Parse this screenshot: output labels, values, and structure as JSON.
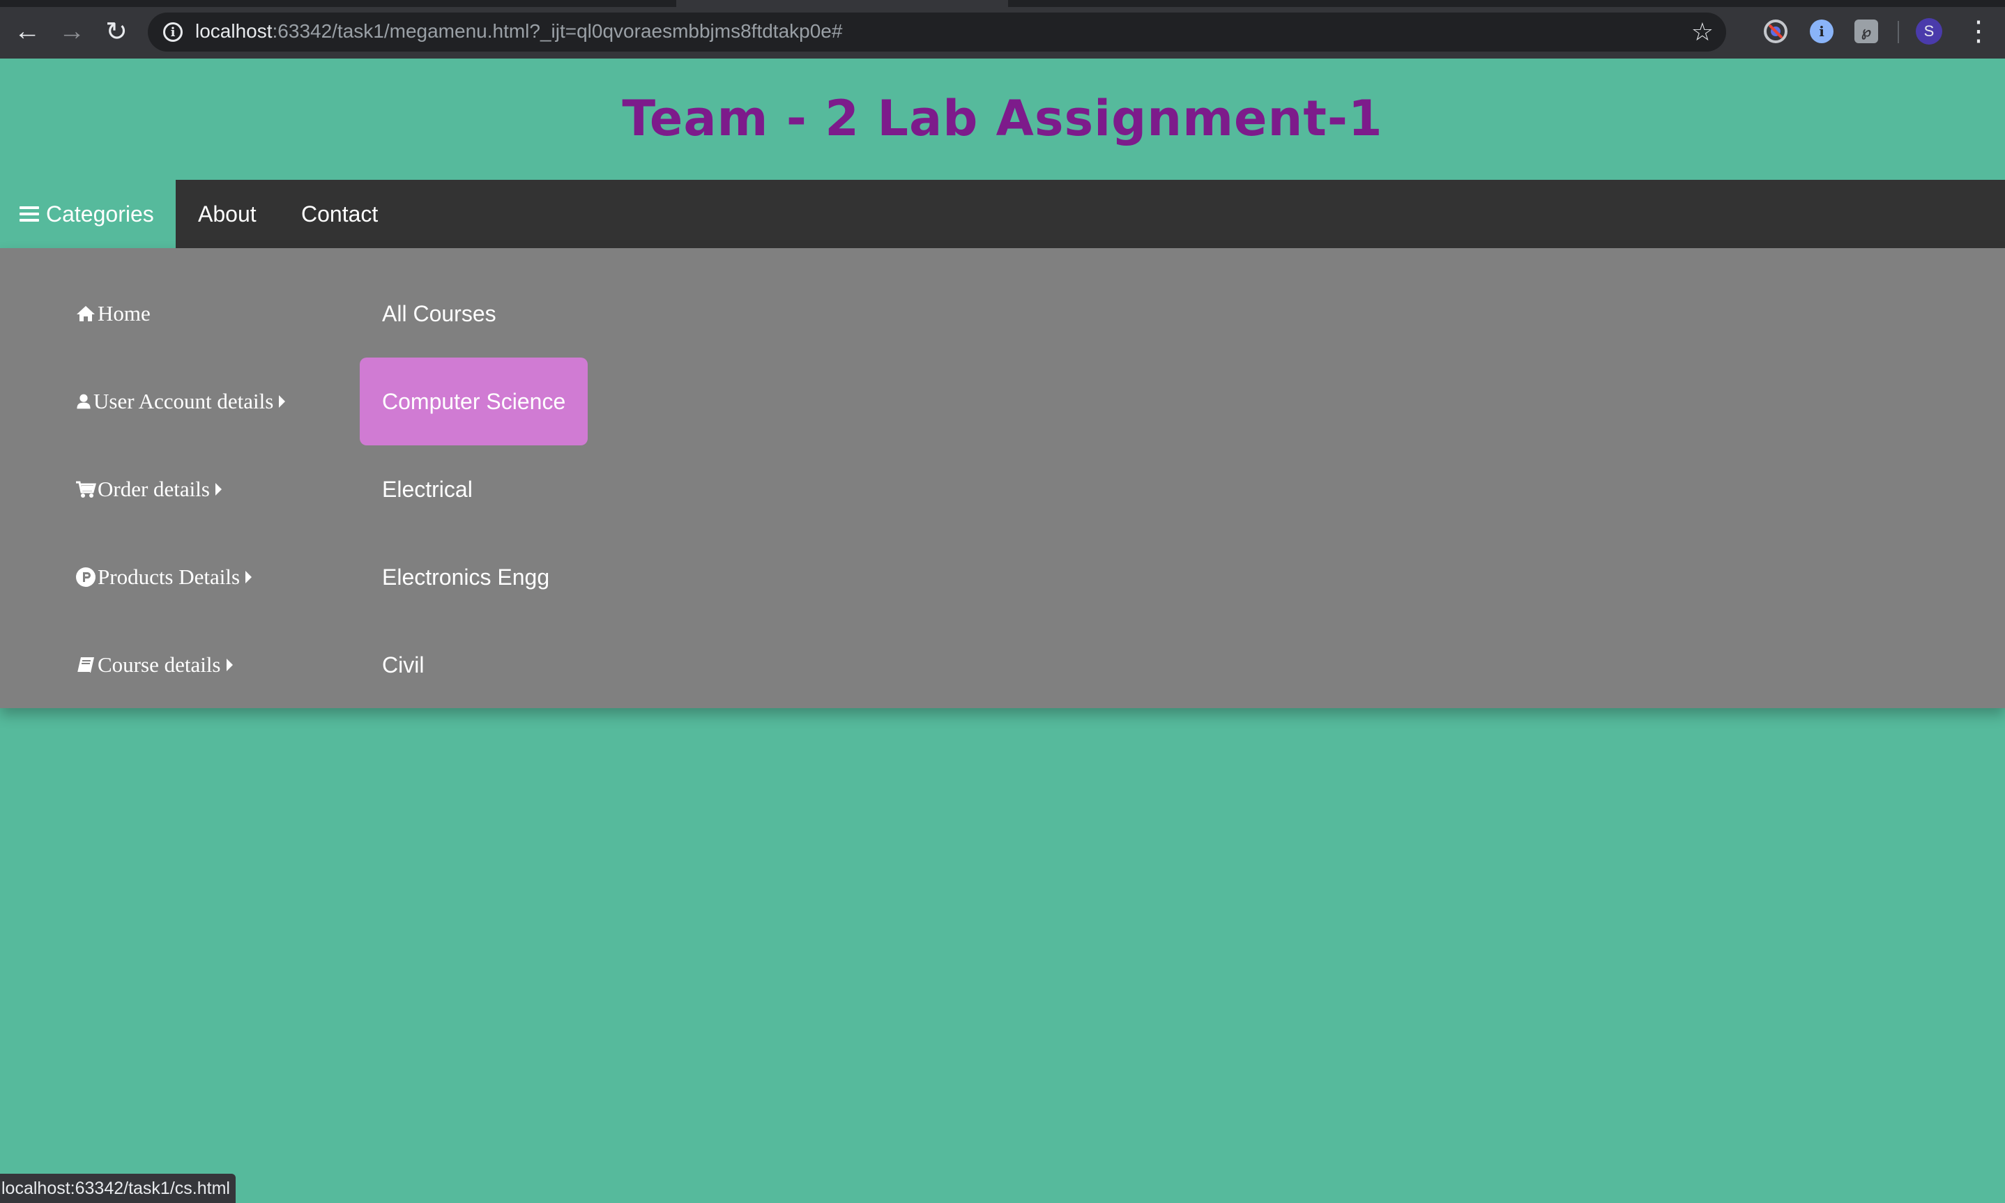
{
  "browser": {
    "url_host": "localhost",
    "url_rest": ":63342/task1/megamenu.html?_ijt=ql0qvoraesmbbjms8ftdtakp0e#",
    "profile_initial": "S",
    "status_url": "localhost:63342/task1/cs.html"
  },
  "page": {
    "title": "Team - 2 Lab Assignment-1"
  },
  "navbar": {
    "categories_label": "Categories",
    "about_label": "About",
    "contact_label": "Contact"
  },
  "megamenu": {
    "left_items": [
      {
        "label": "Home",
        "icon": "home-icon",
        "has_submenu": false
      },
      {
        "label": "User Account details",
        "icon": "user-icon",
        "has_submenu": true
      },
      {
        "label": "Order details",
        "icon": "cart-icon",
        "has_submenu": true
      },
      {
        "label": "Products Details",
        "icon": "product-hunt-icon",
        "has_submenu": true
      },
      {
        "label": "Course details",
        "icon": "book-icon",
        "has_submenu": true
      }
    ],
    "courses": [
      {
        "label": "All Courses",
        "active": false
      },
      {
        "label": "Computer Science",
        "active": true
      },
      {
        "label": "Electrical",
        "active": false
      },
      {
        "label": "Electronics Engg",
        "active": false
      },
      {
        "label": "Civil",
        "active": false
      }
    ]
  },
  "colors": {
    "page_background": "#56ba9c",
    "title": "#7d1b8b",
    "navbar": "#333333",
    "megamenu": "#808080",
    "active_course": "#d07bd3"
  }
}
